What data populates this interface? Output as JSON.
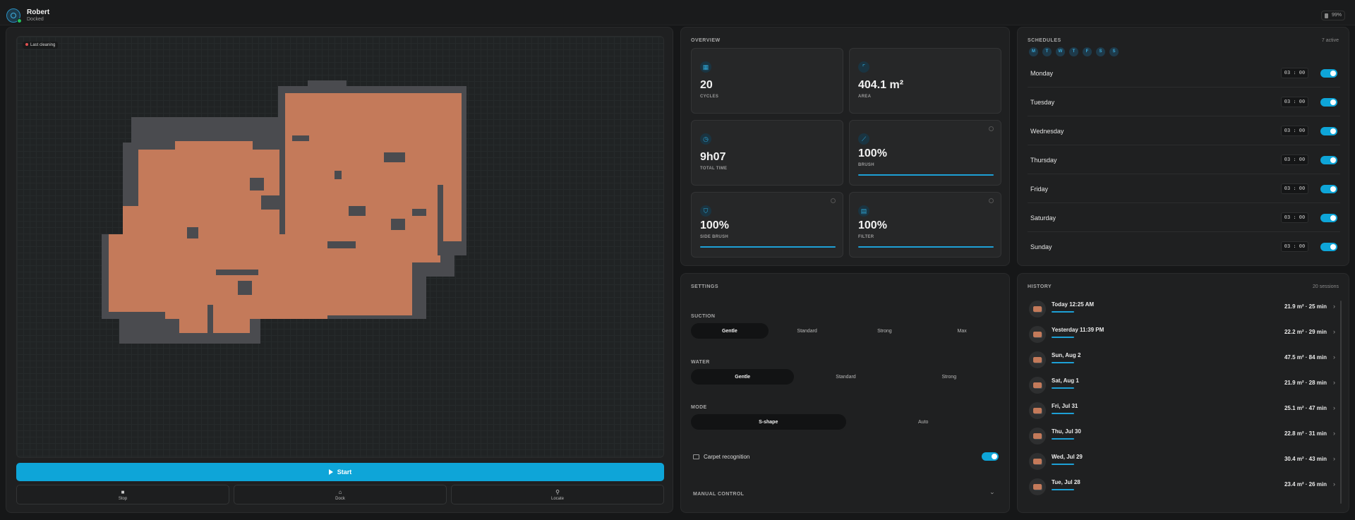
{
  "header": {
    "robot_name": "Robert",
    "robot_status": "Docked",
    "battery": "99%"
  },
  "map": {
    "badge": "Last cleaning",
    "start_label": "Start",
    "controls": [
      {
        "label": "Stop",
        "icon": "stop-icon"
      },
      {
        "label": "Dock",
        "icon": "home-icon"
      },
      {
        "label": "Locate",
        "icon": "pin-icon"
      }
    ],
    "colors": {
      "floor": "#c47a5a",
      "wall": "#4a4b4f"
    }
  },
  "overview": {
    "title": "OVERVIEW",
    "tiles": [
      {
        "value": "20",
        "label": "CYCLES",
        "icon": "grid-icon"
      },
      {
        "value": "404.1 m²",
        "label": "AREA",
        "icon": "area-icon"
      },
      {
        "value": "9h07",
        "label": "TOTAL TIME",
        "icon": "timer-icon"
      },
      {
        "value": "100%",
        "label": "BRUSH",
        "icon": "brush-icon",
        "level": 1.0
      },
      {
        "value": "100%",
        "label": "SIDE BRUSH",
        "icon": "side-brush-icon",
        "level": 1.0
      },
      {
        "value": "100%",
        "label": "FILTER",
        "icon": "filter-icon",
        "level": 1.0
      }
    ]
  },
  "schedules": {
    "title": "SCHEDULES",
    "meta": "7 active",
    "day_chips": [
      "M",
      "T",
      "W",
      "T",
      "F",
      "S",
      "S"
    ],
    "rows": [
      {
        "day": "Monday",
        "time": "03 : 00",
        "enabled": true
      },
      {
        "day": "Tuesday",
        "time": "03 : 00",
        "enabled": true
      },
      {
        "day": "Wednesday",
        "time": "03 : 00",
        "enabled": true
      },
      {
        "day": "Thursday",
        "time": "03 : 00",
        "enabled": true
      },
      {
        "day": "Friday",
        "time": "03 : 00",
        "enabled": true
      },
      {
        "day": "Saturday",
        "time": "03 : 00",
        "enabled": true
      },
      {
        "day": "Sunday",
        "time": "03 : 00",
        "enabled": true
      }
    ]
  },
  "settings": {
    "title": "SETTINGS",
    "suction": {
      "label": "SUCTION",
      "options": [
        "Gentle",
        "Standard",
        "Strong",
        "Max"
      ],
      "selected": "Gentle"
    },
    "water": {
      "label": "WATER",
      "options": [
        "Gentle",
        "Standard",
        "Strong"
      ],
      "selected": "Gentle"
    },
    "mode": {
      "label": "MODE",
      "options": [
        "S-shape",
        "Auto"
      ],
      "selected": "S-shape"
    },
    "carpet_label": "Carpet recognition",
    "carpet_enabled": true,
    "manual_label": "MANUAL CONTROL"
  },
  "history": {
    "title": "HISTORY",
    "meta": "20 sessions",
    "rows": [
      {
        "date": "Today 12:25 AM",
        "stat": "21.9 m² · 25 min"
      },
      {
        "date": "Yesterday 11:39 PM",
        "stat": "22.2 m² · 29 min"
      },
      {
        "date": "Sun, Aug 2",
        "stat": "47.5 m² · 84 min"
      },
      {
        "date": "Sat, Aug 1",
        "stat": "21.9 m² · 28 min"
      },
      {
        "date": "Fri, Jul 31",
        "stat": "25.1 m² · 47 min"
      },
      {
        "date": "Thu, Jul 30",
        "stat": "22.8 m² · 31 min"
      },
      {
        "date": "Wed, Jul 29",
        "stat": "30.4 m² · 43 min"
      },
      {
        "date": "Tue, Jul 28",
        "stat": "23.4 m² · 26 min"
      }
    ]
  }
}
